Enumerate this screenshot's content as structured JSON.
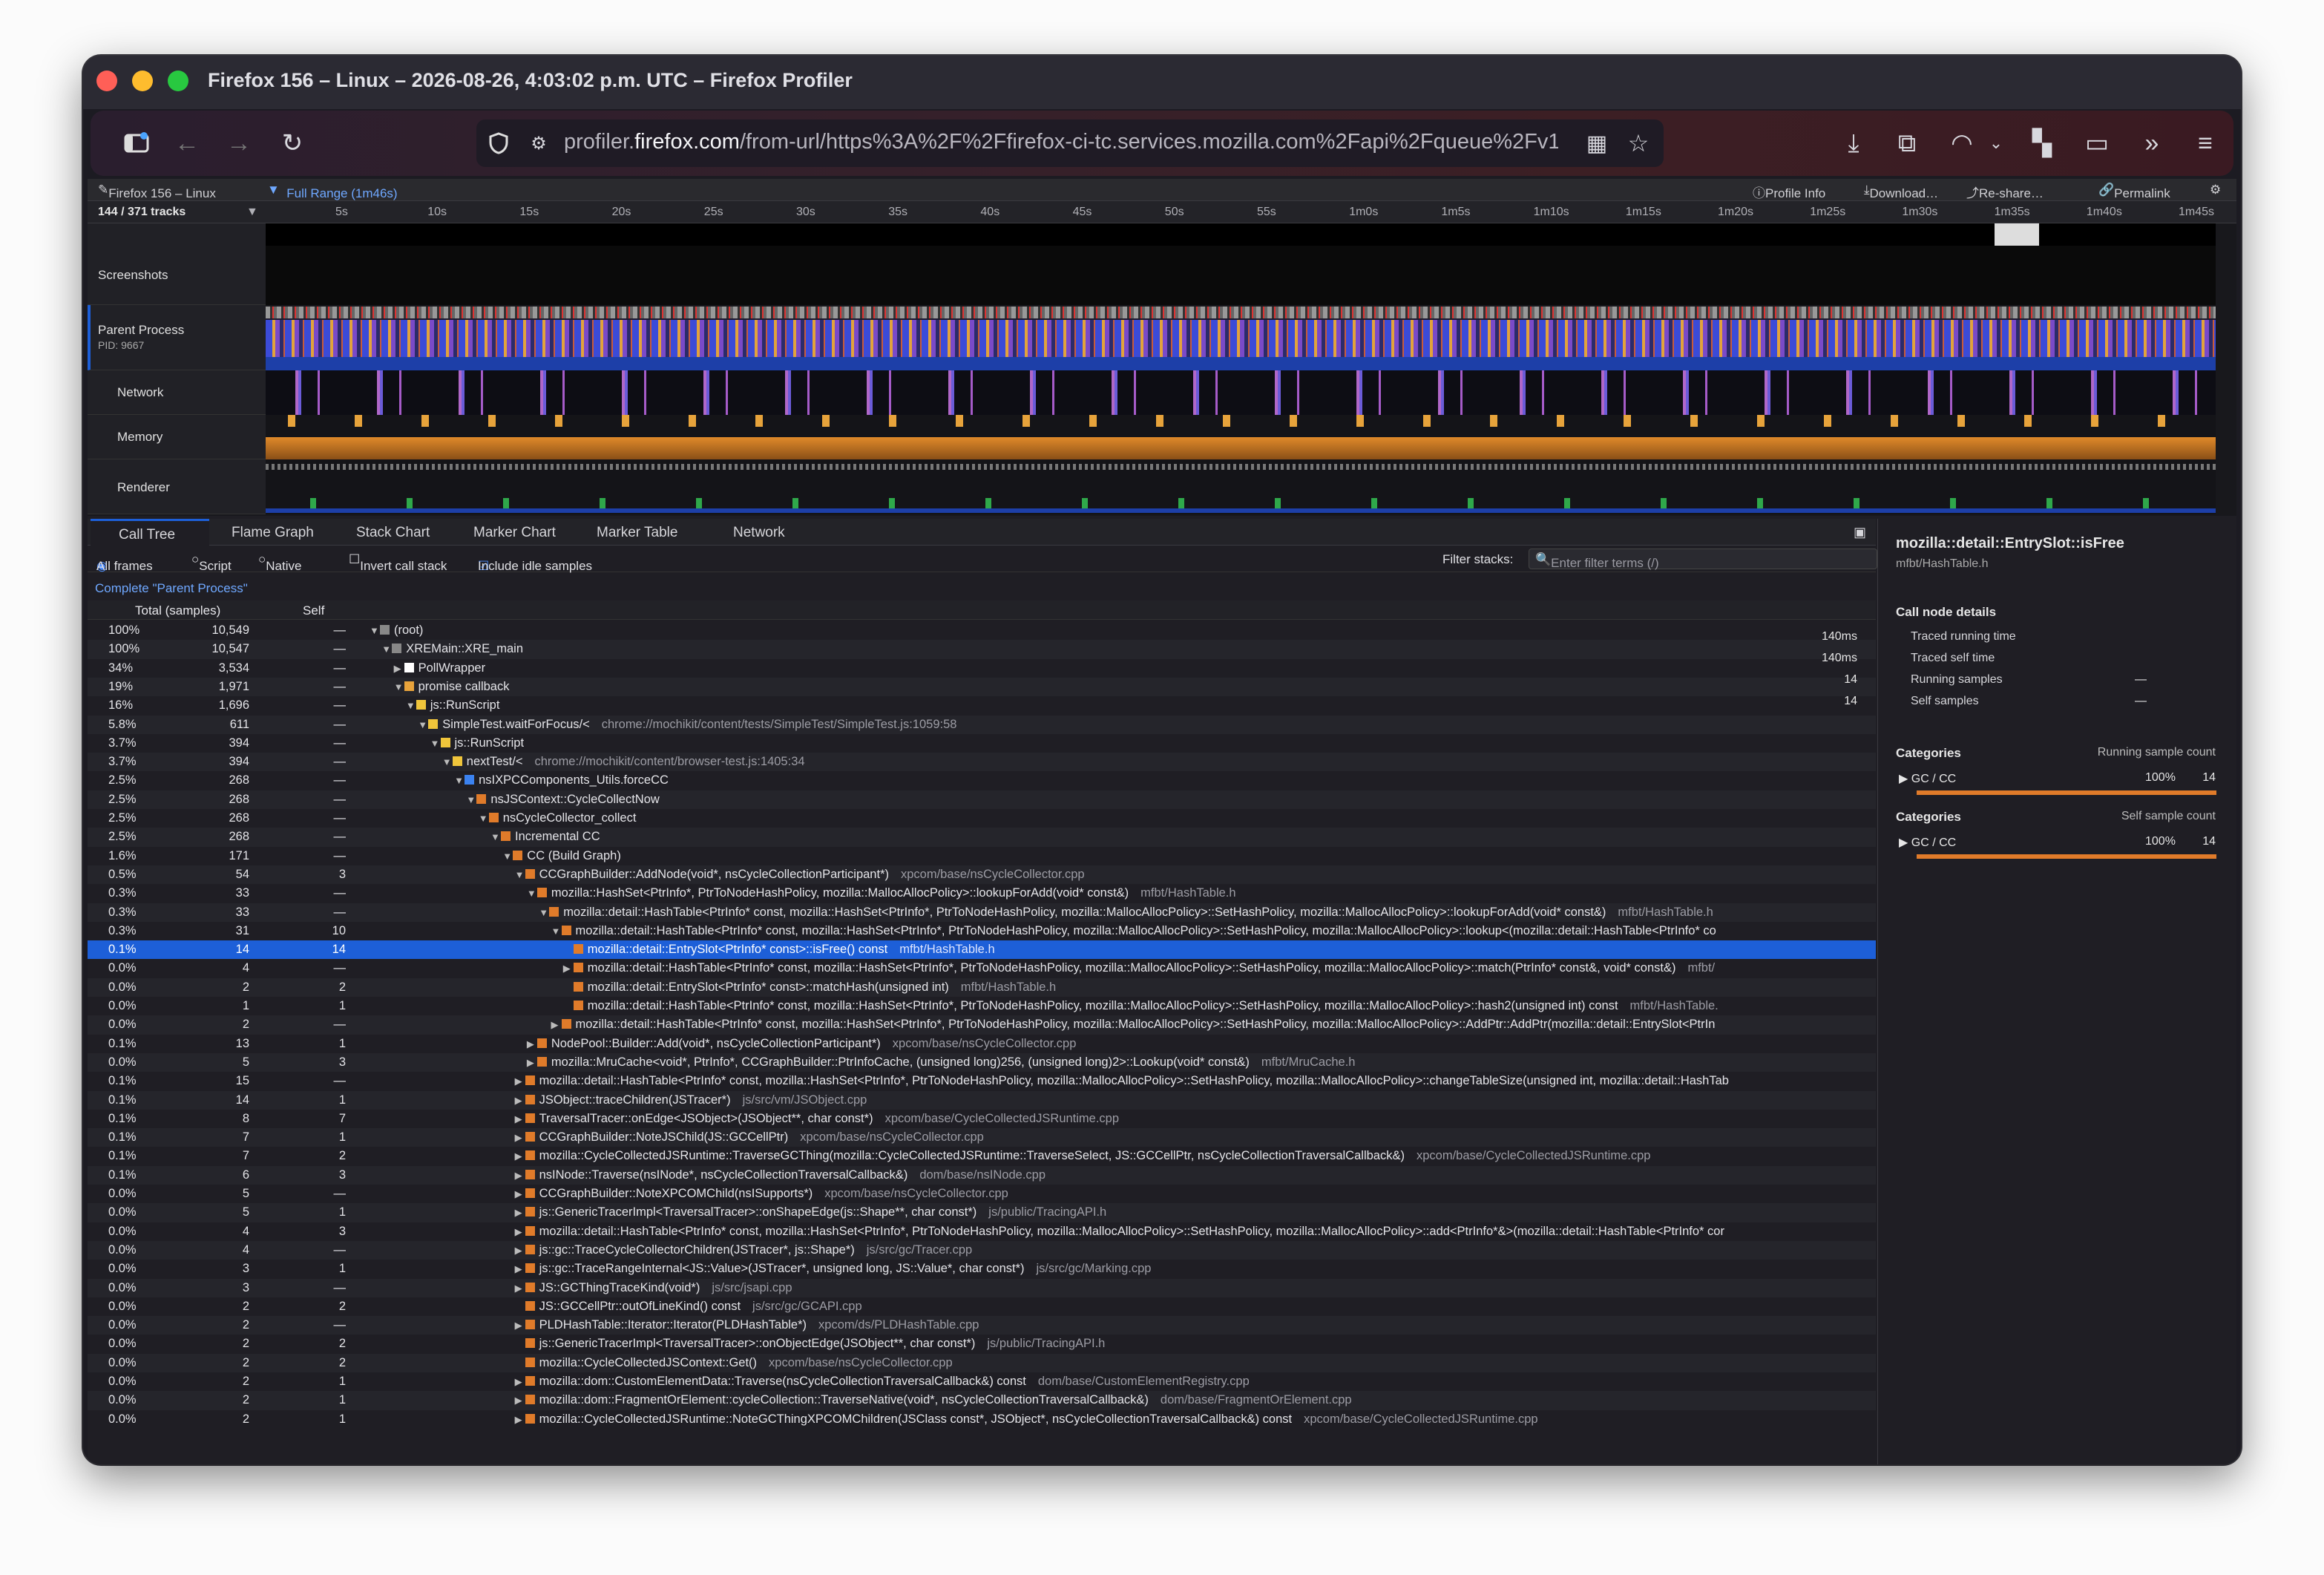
{
  "window": {
    "title": "Firefox 156 – Linux – 2026-08-26, 4:03:02 p.m. UTC – Firefox Profiler"
  },
  "url": {
    "prefix": "profiler.",
    "domain": "firefox.com",
    "rest": "/from-url/https%3A%2F%2Ffirefox-ci-tc.services.mozilla.com%2Fapi%2Fqueue%2Fv1"
  },
  "topbar": {
    "profile_name": "Firefox 156 – Linux",
    "range": "Full Range (1m46s)",
    "profile_info": "Profile Info",
    "download": "Download…",
    "reshare": "Re-share…",
    "permalink": "Permalink"
  },
  "timeline": {
    "track_count": "144 / 371 tracks",
    "ticks": [
      "5s",
      "10s",
      "15s",
      "20s",
      "25s",
      "30s",
      "35s",
      "40s",
      "45s",
      "50s",
      "55s",
      "1m0s",
      "1m5s",
      "1m10s",
      "1m15s",
      "1m20s",
      "1m25s",
      "1m30s",
      "1m35s",
      "1m40s",
      "1m45s"
    ]
  },
  "tracks": {
    "screenshots": "Screenshots",
    "parent": "Parent Process",
    "pid": "PID: 9667",
    "network": "Network",
    "memory": "Memory",
    "renderer": "Renderer"
  },
  "tabs": [
    "Call Tree",
    "Flame Graph",
    "Stack Chart",
    "Marker Chart",
    "Marker Table",
    "Network"
  ],
  "options": {
    "all_frames": "All frames",
    "script": "Script",
    "native": "Native",
    "invert": "Invert call stack",
    "idle": "Include idle samples",
    "filter_label": "Filter stacks:",
    "filter_placeholder": "Enter filter terms (/)"
  },
  "breadcrumb": "Complete \"Parent Process\"",
  "tree_header": {
    "total": "Total (samples)",
    "self": "Self"
  },
  "rows": [
    {
      "p": "100%",
      "n": "10,549",
      "s": "—",
      "d": 0,
      "t": "▼",
      "c": "#888",
      "f": "(root)",
      "l": ""
    },
    {
      "p": "100%",
      "n": "10,547",
      "s": "—",
      "d": 1,
      "t": "▼",
      "c": "#888",
      "f": "XREMain::XRE_main",
      "l": ""
    },
    {
      "p": "34%",
      "n": "3,534",
      "s": "—",
      "d": 2,
      "t": "▶",
      "c": "#fff",
      "f": "PollWrapper",
      "l": ""
    },
    {
      "p": "19%",
      "n": "1,971",
      "s": "—",
      "d": 2,
      "t": "▼",
      "c": "#e8a33b",
      "f": "promise callback",
      "l": ""
    },
    {
      "p": "16%",
      "n": "1,696",
      "s": "—",
      "d": 3,
      "t": "▼",
      "c": "#f0c53b",
      "f": "js::RunScript",
      "l": ""
    },
    {
      "p": "5.8%",
      "n": "611",
      "s": "—",
      "d": 4,
      "t": "▼",
      "c": "#f0c53b",
      "f": "SimpleTest.waitForFocus/<",
      "l": "chrome://mochikit/content/tests/SimpleTest/SimpleTest.js:1059:58"
    },
    {
      "p": "3.7%",
      "n": "394",
      "s": "—",
      "d": 5,
      "t": "▼",
      "c": "#f0c53b",
      "f": "js::RunScript",
      "l": ""
    },
    {
      "p": "3.7%",
      "n": "394",
      "s": "—",
      "d": 6,
      "t": "▼",
      "c": "#f0c53b",
      "f": "nextTest/<",
      "l": "chrome://mochikit/content/browser-test.js:1405:34"
    },
    {
      "p": "2.5%",
      "n": "268",
      "s": "—",
      "d": 7,
      "t": "▼",
      "c": "#3b82f0",
      "f": "nsIXPCComponents_Utils.forceCC",
      "l": ""
    },
    {
      "p": "2.5%",
      "n": "268",
      "s": "—",
      "d": 8,
      "t": "▼",
      "c": "#e07b2a",
      "f": "nsJSContext::CycleCollectNow",
      "l": ""
    },
    {
      "p": "2.5%",
      "n": "268",
      "s": "—",
      "d": 9,
      "t": "▼",
      "c": "#e07b2a",
      "f": "nsCycleCollector_collect",
      "l": ""
    },
    {
      "p": "2.5%",
      "n": "268",
      "s": "—",
      "d": 10,
      "t": "▼",
      "c": "#e07b2a",
      "f": "Incremental CC",
      "l": ""
    },
    {
      "p": "1.6%",
      "n": "171",
      "s": "—",
      "d": 11,
      "t": "▼",
      "c": "#e07b2a",
      "f": "CC (Build Graph)",
      "l": ""
    },
    {
      "p": "0.5%",
      "n": "54",
      "s": "3",
      "d": 12,
      "t": "▼",
      "c": "#e07b2a",
      "f": "CCGraphBuilder::AddNode(void*, nsCycleCollectionParticipant*)",
      "l": "xpcom/base/nsCycleCollector.cpp"
    },
    {
      "p": "0.3%",
      "n": "33",
      "s": "—",
      "d": 13,
      "t": "▼",
      "c": "#e07b2a",
      "f": "mozilla::HashSet<PtrInfo*, PtrToNodeHashPolicy, mozilla::MallocAllocPolicy>::lookupForAdd(void* const&)",
      "l": "mfbt/HashTable.h"
    },
    {
      "p": "0.3%",
      "n": "33",
      "s": "—",
      "d": 14,
      "t": "▼",
      "c": "#e07b2a",
      "f": "mozilla::detail::HashTable<PtrInfo* const, mozilla::HashSet<PtrInfo*, PtrToNodeHashPolicy, mozilla::MallocAllocPolicy>::SetHashPolicy, mozilla::MallocAllocPolicy>::lookupForAdd(void* const&)",
      "l": "mfbt/HashTable.h"
    },
    {
      "p": "0.3%",
      "n": "31",
      "s": "10",
      "d": 15,
      "t": "▼",
      "c": "#e07b2a",
      "f": "mozilla::detail::HashTable<PtrInfo* const, mozilla::HashSet<PtrInfo*, PtrToNodeHashPolicy, mozilla::MallocAllocPolicy>::SetHashPolicy, mozilla::MallocAllocPolicy>::lookup<(mozilla::detail::HashTable<PtrInfo* co",
      "l": ""
    },
    {
      "p": "0.1%",
      "n": "14",
      "s": "14",
      "d": 16,
      "t": "",
      "c": "#e07b2a",
      "f": "mozilla::detail::EntrySlot<PtrInfo* const>::isFree() const",
      "l": "mfbt/HashTable.h",
      "sel": true
    },
    {
      "p": "0.0%",
      "n": "4",
      "s": "—",
      "d": 16,
      "t": "▶",
      "c": "#e07b2a",
      "f": "mozilla::detail::HashTable<PtrInfo* const, mozilla::HashSet<PtrInfo*, PtrToNodeHashPolicy, mozilla::MallocAllocPolicy>::SetHashPolicy, mozilla::MallocAllocPolicy>::match(PtrInfo* const&, void* const&)",
      "l": "mfbt/"
    },
    {
      "p": "0.0%",
      "n": "2",
      "s": "2",
      "d": 16,
      "t": "",
      "c": "#e07b2a",
      "f": "mozilla::detail::EntrySlot<PtrInfo* const>::matchHash(unsigned int)",
      "l": "mfbt/HashTable.h"
    },
    {
      "p": "0.0%",
      "n": "1",
      "s": "1",
      "d": 16,
      "t": "",
      "c": "#e07b2a",
      "f": "mozilla::detail::HashTable<PtrInfo* const, mozilla::HashSet<PtrInfo*, PtrToNodeHashPolicy, mozilla::MallocAllocPolicy>::SetHashPolicy, mozilla::MallocAllocPolicy>::hash2(unsigned int) const",
      "l": "mfbt/HashTable."
    },
    {
      "p": "0.0%",
      "n": "2",
      "s": "—",
      "d": 15,
      "t": "▶",
      "c": "#e07b2a",
      "f": "mozilla::detail::HashTable<PtrInfo* const, mozilla::HashSet<PtrInfo*, PtrToNodeHashPolicy, mozilla::MallocAllocPolicy>::SetHashPolicy, mozilla::MallocAllocPolicy>::AddPtr::AddPtr(mozilla::detail::EntrySlot<PtrIn",
      "l": ""
    },
    {
      "p": "0.1%",
      "n": "13",
      "s": "1",
      "d": 13,
      "t": "▶",
      "c": "#e07b2a",
      "f": "NodePool::Builder::Add(void*, nsCycleCollectionParticipant*)",
      "l": "xpcom/base/nsCycleCollector.cpp"
    },
    {
      "p": "0.0%",
      "n": "5",
      "s": "3",
      "d": 13,
      "t": "▶",
      "c": "#e07b2a",
      "f": "mozilla::MruCache<void*, PtrInfo*, CCGraphBuilder::PtrInfoCache, (unsigned long)256, (unsigned long)2>::Lookup(void* const&)",
      "l": "mfbt/MruCache.h"
    },
    {
      "p": "0.1%",
      "n": "15",
      "s": "—",
      "d": 12,
      "t": "▶",
      "c": "#e07b2a",
      "f": "mozilla::detail::HashTable<PtrInfo* const, mozilla::HashSet<PtrInfo*, PtrToNodeHashPolicy, mozilla::MallocAllocPolicy>::SetHashPolicy, mozilla::MallocAllocPolicy>::changeTableSize(unsigned int, mozilla::detail::HashTab",
      "l": ""
    },
    {
      "p": "0.1%",
      "n": "14",
      "s": "1",
      "d": 12,
      "t": "▶",
      "c": "#e07b2a",
      "f": "JSObject::traceChildren(JSTracer*)",
      "l": "js/src/vm/JSObject.cpp"
    },
    {
      "p": "0.1%",
      "n": "8",
      "s": "7",
      "d": 12,
      "t": "▶",
      "c": "#e07b2a",
      "f": "TraversalTracer::onEdge<JSObject>(JSObject**, char const*)",
      "l": "xpcom/base/CycleCollectedJSRuntime.cpp"
    },
    {
      "p": "0.1%",
      "n": "7",
      "s": "1",
      "d": 12,
      "t": "▶",
      "c": "#e07b2a",
      "f": "CCGraphBuilder::NoteJSChild(JS::GCCellPtr)",
      "l": "xpcom/base/nsCycleCollector.cpp"
    },
    {
      "p": "0.1%",
      "n": "7",
      "s": "2",
      "d": 12,
      "t": "▶",
      "c": "#e07b2a",
      "f": "mozilla::CycleCollectedJSRuntime::TraverseGCThing(mozilla::CycleCollectedJSRuntime::TraverseSelect, JS::GCCellPtr, nsCycleCollectionTraversalCallback&)",
      "l": "xpcom/base/CycleCollectedJSRuntime.cpp"
    },
    {
      "p": "0.1%",
      "n": "6",
      "s": "3",
      "d": 12,
      "t": "▶",
      "c": "#e07b2a",
      "f": "nsINode::Traverse(nsINode*, nsCycleCollectionTraversalCallback&)",
      "l": "dom/base/nsINode.cpp"
    },
    {
      "p": "0.0%",
      "n": "5",
      "s": "—",
      "d": 12,
      "t": "▶",
      "c": "#e07b2a",
      "f": "CCGraphBuilder::NoteXPCOMChild(nsISupports*)",
      "l": "xpcom/base/nsCycleCollector.cpp"
    },
    {
      "p": "0.0%",
      "n": "5",
      "s": "1",
      "d": 12,
      "t": "▶",
      "c": "#e07b2a",
      "f": "js::GenericTracerImpl<TraversalTracer>::onShapeEdge(js::Shape**, char const*)",
      "l": "js/public/TracingAPI.h"
    },
    {
      "p": "0.0%",
      "n": "4",
      "s": "3",
      "d": 12,
      "t": "▶",
      "c": "#e07b2a",
      "f": "mozilla::detail::HashTable<PtrInfo* const, mozilla::HashSet<PtrInfo*, PtrToNodeHashPolicy, mozilla::MallocAllocPolicy>::SetHashPolicy, mozilla::MallocAllocPolicy>::add<PtrInfo*&>(mozilla::detail::HashTable<PtrInfo* cor",
      "l": ""
    },
    {
      "p": "0.0%",
      "n": "4",
      "s": "—",
      "d": 12,
      "t": "▶",
      "c": "#e07b2a",
      "f": "js::gc::TraceCycleCollectorChildren(JSTracer*, js::Shape*)",
      "l": "js/src/gc/Tracer.cpp"
    },
    {
      "p": "0.0%",
      "n": "3",
      "s": "1",
      "d": 12,
      "t": "▶",
      "c": "#e07b2a",
      "f": "js::gc::TraceRangeInternal<JS::Value>(JSTracer*, unsigned long, JS::Value*, char const*)",
      "l": "js/src/gc/Marking.cpp"
    },
    {
      "p": "0.0%",
      "n": "3",
      "s": "—",
      "d": 12,
      "t": "▶",
      "c": "#e07b2a",
      "f": "JS::GCThingTraceKind(void*)",
      "l": "js/src/jsapi.cpp"
    },
    {
      "p": "0.0%",
      "n": "2",
      "s": "2",
      "d": 12,
      "t": "",
      "c": "#e07b2a",
      "f": "JS::GCCellPtr::outOfLineKind() const",
      "l": "js/src/gc/GCAPI.cpp"
    },
    {
      "p": "0.0%",
      "n": "2",
      "s": "—",
      "d": 12,
      "t": "▶",
      "c": "#e07b2a",
      "f": "PLDHashTable::Iterator::Iterator(PLDHashTable*)",
      "l": "xpcom/ds/PLDHashTable.cpp"
    },
    {
      "p": "0.0%",
      "n": "2",
      "s": "2",
      "d": 12,
      "t": "",
      "c": "#e07b2a",
      "f": "js::GenericTracerImpl<TraversalTracer>::onObjectEdge(JSObject**, char const*)",
      "l": "js/public/TracingAPI.h"
    },
    {
      "p": "0.0%",
      "n": "2",
      "s": "2",
      "d": 12,
      "t": "",
      "c": "#e07b2a",
      "f": "mozilla::CycleCollectedJSContext::Get()",
      "l": "xpcom/base/nsCycleCollector.cpp"
    },
    {
      "p": "0.0%",
      "n": "2",
      "s": "1",
      "d": 12,
      "t": "▶",
      "c": "#e07b2a",
      "f": "mozilla::dom::CustomElementData::Traverse(nsCycleCollectionTraversalCallback&) const",
      "l": "dom/base/CustomElementRegistry.cpp"
    },
    {
      "p": "0.0%",
      "n": "2",
      "s": "1",
      "d": 12,
      "t": "▶",
      "c": "#e07b2a",
      "f": "mozilla::dom::FragmentOrElement::cycleCollection::TraverseNative(void*, nsCycleCollectionTraversalCallback&)",
      "l": "dom/base/FragmentOrElement.cpp"
    },
    {
      "p": "0.0%",
      "n": "2",
      "s": "1",
      "d": 12,
      "t": "▶",
      "c": "#e07b2a",
      "f": "mozilla::CycleCollectedJSRuntime::NoteGCThingXPCOMChildren(JSClass const*, JSObject*, nsCycleCollectionTraversalCallback&) const",
      "l": "xpcom/base/CycleCollectedJSRuntime.cpp"
    }
  ],
  "sidebar": {
    "title": "mozilla::detail::EntrySlot::isFree",
    "file": "mfbt/HashTable.h",
    "details_heading": "Call node details",
    "details": [
      {
        "k": "Traced running time",
        "v": "140ms",
        "d": ""
      },
      {
        "k": "Traced self time",
        "v": "140ms",
        "d": ""
      },
      {
        "k": "Running samples",
        "v": "14",
        "d": "—"
      },
      {
        "k": "Self samples",
        "v": "14",
        "d": "—"
      }
    ],
    "cat1": {
      "label": "Categories",
      "right": "Running sample count",
      "name": "GC / CC",
      "pct": "100%",
      "count": "14"
    },
    "cat2": {
      "label": "Categories",
      "right": "Self sample count",
      "name": "GC / CC",
      "pct": "100%",
      "count": "14"
    }
  },
  "colors": {
    "accent": "#1d5fd8",
    "gc_cc": "#e07b2a",
    "js": "#f0c53b",
    "dom": "#3b82f0"
  }
}
